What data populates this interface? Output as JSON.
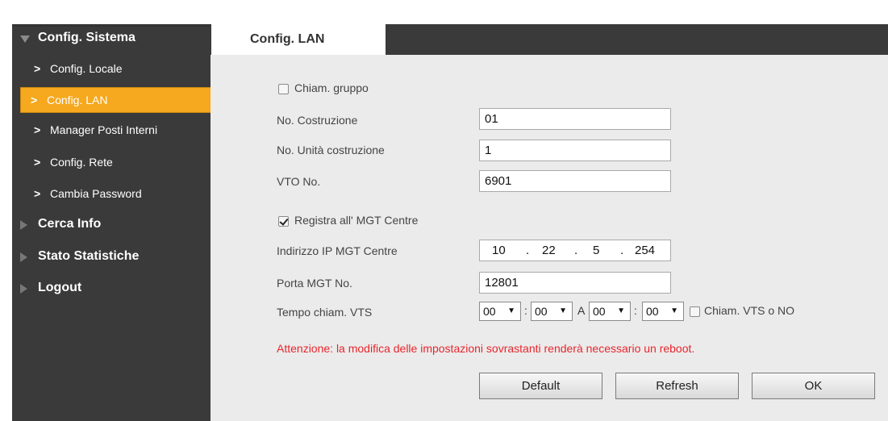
{
  "sidebar": {
    "sections": [
      {
        "label": "Config. Sistema"
      },
      {
        "label": "Cerca Info"
      },
      {
        "label": "Stato Statistiche"
      },
      {
        "label": "Logout"
      }
    ],
    "items": [
      {
        "label": "Config. Locale"
      },
      {
        "label": "Config. LAN"
      },
      {
        "label": "Manager Posti Interni"
      },
      {
        "label": "Config. Rete"
      },
      {
        "label": "Cambia Password"
      }
    ],
    "active_item": "Config. LAN"
  },
  "tab": {
    "label": "Config. LAN"
  },
  "form": {
    "group_call_label": "Chiam. gruppo",
    "group_call_checked": false,
    "building_no_label": "No. Costruzione",
    "building_no_value": "01",
    "building_unit_label": "No. Unità costruzione",
    "building_unit_value": "1",
    "vto_no_label": "VTO No.",
    "vto_no_value": "6901",
    "register_mgt_label": "Registra all' MGT Centre",
    "register_mgt_checked": true,
    "mgt_ip_label": "Indirizzo IP MGT Centre",
    "mgt_ip": {
      "o1": "10",
      "o2": "22",
      "o3": "5",
      "o4": "254",
      "dot": "."
    },
    "mgt_port_label": "Porta MGT No.",
    "mgt_port_value": "12801",
    "vts_time_label": "Tempo chiam. VTS",
    "vts_time": {
      "h1": "00",
      "m1": "00",
      "sep_a": "A",
      "h2": "00",
      "m2": "00",
      "colon": ":"
    },
    "vts_or_no_label": "Chiam. VTS o NO",
    "vts_or_no_checked": false,
    "warning": "Attenzione: la modifica delle impostazioni sovrastanti renderà necessario un reboot."
  },
  "buttons": {
    "default": "Default",
    "refresh": "Refresh",
    "ok": "OK"
  },
  "icons": {
    "dropdown": "▼",
    "chevron": ">"
  },
  "colors": {
    "accent": "#f6a81e",
    "sidebar_bg": "#3a3a3a",
    "content_bg": "#ebebeb",
    "warning": "#e8262d"
  }
}
